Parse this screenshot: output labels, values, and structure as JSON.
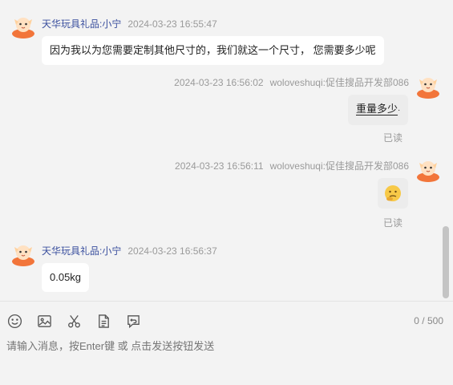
{
  "messages": [
    {
      "side": "left",
      "sender": "天华玩具礼品:小宁",
      "time": "2024-03-23 16:55:47",
      "text": "因为我以为您需要定制其他尺寸的，我们就这一个尺寸， 您需要多少呢"
    },
    {
      "side": "right",
      "sender": "woloveshuqi:促佳搜品开发部086",
      "time": "2024-03-23 16:56:02",
      "text": "重量多少",
      "status": "已读"
    },
    {
      "side": "right",
      "sender": "woloveshuqi:促佳搜品开发部086",
      "time": "2024-03-23 16:56:11",
      "emoji": "🤔",
      "status": "已读"
    },
    {
      "side": "left",
      "sender": "天华玩具礼品:小宁",
      "time": "2024-03-23 16:56:37",
      "text": "0.05kg"
    }
  ],
  "toolbar": {
    "icons": [
      "smiley-icon",
      "image-icon",
      "scissors-icon",
      "document-icon",
      "recall-icon"
    ]
  },
  "input": {
    "placeholder": "请输入消息，按Enter键 或 点击发送按钮发送",
    "counter": "0 / 500"
  },
  "colors": {
    "sender_name": "#3a4f9e",
    "avatar_orange": "#f2753a",
    "background": "#f3f3f3"
  }
}
